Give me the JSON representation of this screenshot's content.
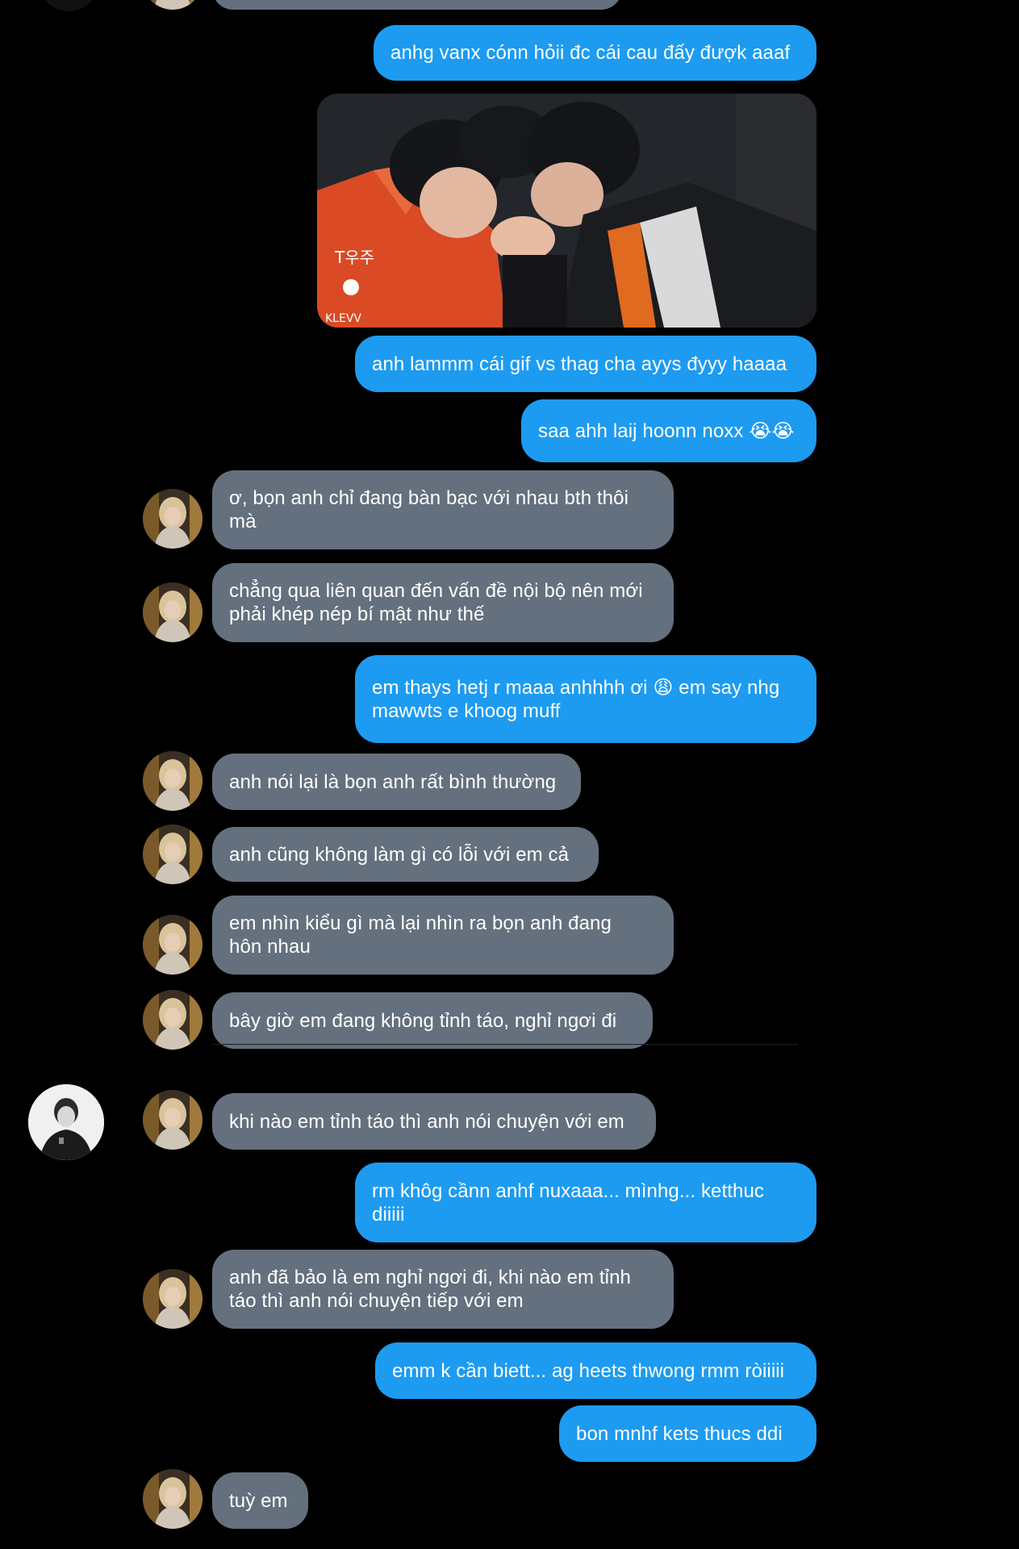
{
  "conversation": {
    "top_bubble_partial": "",
    "messages": [
      {
        "id": "m1",
        "from": "me",
        "text": "anhg vanx cónn hỏii đc cái cau đấy đượk aaaf"
      },
      {
        "id": "m2",
        "from": "me",
        "type": "gif",
        "icon": "gif-image"
      },
      {
        "id": "m3",
        "from": "me",
        "text": "anh lammm cái gif vs thag cha ayys đyyy haaaa"
      },
      {
        "id": "m4",
        "from": "me",
        "text": "saa ahh laij hoonn noxx 😭😭"
      },
      {
        "id": "m5",
        "from": "them",
        "text": "ơ, bọn anh chỉ đang bàn bạc với nhau bth thôi\nmà"
      },
      {
        "id": "m6",
        "from": "them",
        "text": "chẳng qua liên quan đến vấn đề nội bộ nên mới\nphải khép nép bí mật như thế"
      },
      {
        "id": "m7",
        "from": "me",
        "text": "em thays hetj r maaa anhhhh ơi 😩 em say nhg\nmawwts e khoog muff"
      },
      {
        "id": "m8",
        "from": "them",
        "text": "anh nói lại là bọn anh rất bình thường"
      },
      {
        "id": "m9",
        "from": "them",
        "text": "anh cũng không làm gì có lỗi với em cả"
      },
      {
        "id": "m10",
        "from": "them",
        "text": "em nhìn kiểu gì mà lại nhìn ra bọn anh đang\nhôn nhau"
      },
      {
        "id": "m11",
        "from": "them",
        "text": "bây giờ em đang không tỉnh táo, nghỉ ngơi đi"
      },
      {
        "id": "m12",
        "from": "them",
        "text": "khi nào em tỉnh táo thì anh nói chuyện với em"
      },
      {
        "id": "m13",
        "from": "me",
        "text": "rm khôg cầnn anhf nuxaaa... mìnhg... ketthuc\ndiiiii"
      },
      {
        "id": "m14",
        "from": "them",
        "text": "anh đã bảo là em nghỉ ngơi đi, khi nào em tỉnh\ntáo thì anh nói chuyện tiếp với em"
      },
      {
        "id": "m15",
        "from": "me",
        "text": "emm k cần biett... ag heets thwong rmm ròiiiii"
      },
      {
        "id": "m16",
        "from": "me",
        "text": "bon mnhf kets thucs ddi"
      },
      {
        "id": "m17",
        "from": "them",
        "text": "tuỳ em"
      }
    ]
  },
  "colors": {
    "background": "#000000",
    "sent_bubble": "#1d9bf0",
    "received_bubble": "#64707d",
    "text": "#ffffff"
  },
  "icons": {
    "contact_avatar": "avatar-icon",
    "side_profile_avatar": "profile-avatar-icon"
  }
}
